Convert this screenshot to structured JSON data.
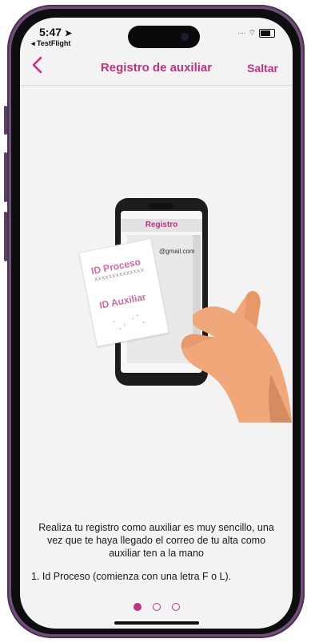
{
  "status_bar": {
    "time": "5:47",
    "back_app": "◂ TestFlight"
  },
  "nav": {
    "back_icon": "chevron-left",
    "title": "Registro de auxiliar",
    "skip_label": "Saltar"
  },
  "illustration": {
    "phone_header": "Registro",
    "phone_email": "@gmail.com",
    "card_line1": "ID Proceso",
    "card_sub": "XXXXXXXXXXXXXX",
    "card_line2": "ID Auxiliar"
  },
  "content": {
    "description": "Realiza tu registro como auxiliar es muy sencillo, una vez que te haya llegado el correo de tu alta como auxiliar ten a la mano",
    "list_item_1": "1. Id Proceso (comienza con una letra F o L)."
  },
  "pagination": {
    "pages": 3,
    "current": 1
  },
  "colors": {
    "accent": "#c4317f",
    "frame": "#6f4f7a",
    "screen_bg": "#f3f3f3",
    "skin": "#f0a87a"
  }
}
